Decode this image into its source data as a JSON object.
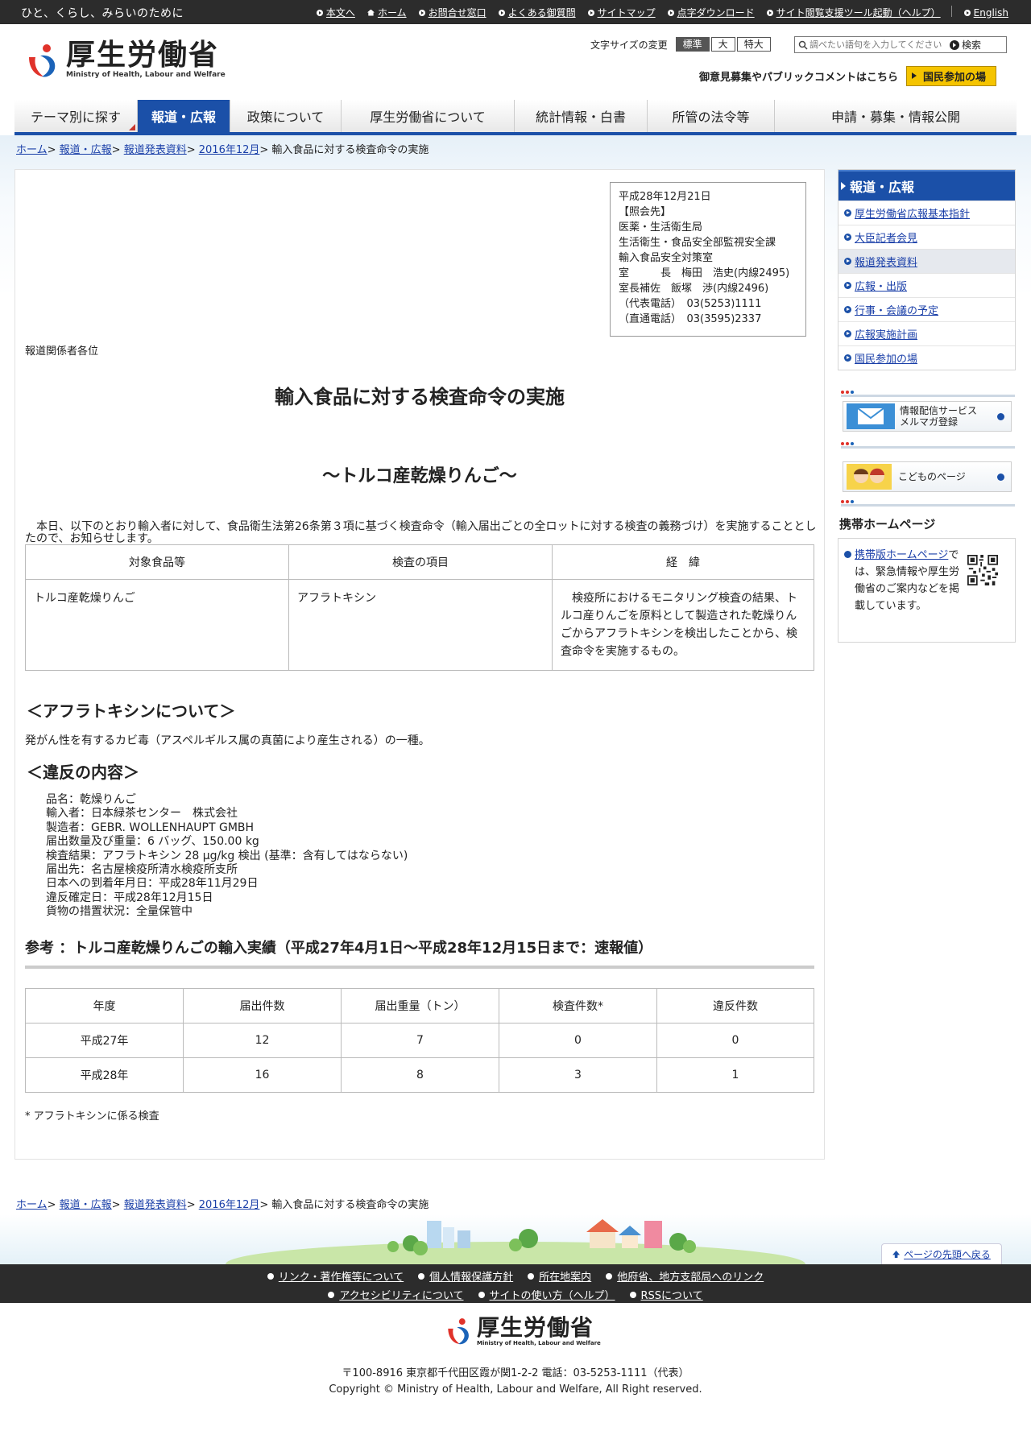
{
  "topbar": {
    "tagline": "ひと、くらし、みらいのために",
    "links": [
      "本文へ",
      "ホーム",
      "お問合せ窓口",
      "よくある御質問",
      "サイトマップ",
      "点字ダウンロード",
      "サイト閲覧支援ツール起動（ヘルプ）"
    ],
    "english": "English"
  },
  "header": {
    "logo_ja": "厚生労働省",
    "logo_en": "Ministry of Health, Labour and Welfare",
    "fontsize_label": "文字サイズの変更",
    "fontsize_options": [
      "標準",
      "大",
      "特大"
    ],
    "search_placeholder": "調べたい語句を入力してください",
    "search_button": "検索",
    "opinion_text": "御意見募集やパブリックコメントはこちら",
    "opinion_button": "国民参加の場"
  },
  "nav": [
    "テーマ別に探す",
    "報道・広報",
    "政策について",
    "厚生労働省について",
    "統計情報・白書",
    "所管の法令等",
    "申請・募集・情報公開"
  ],
  "breadcrumb": {
    "items": [
      "ホーム",
      "報道・広報",
      "報道発表資料",
      "2016年12月"
    ],
    "current": "輸入食品に対する検査命令の実施"
  },
  "contact": "平成28年12月21日\n【照会先】\n医薬・生活衛生局\n生活衛生・食品安全部監視安全課\n輸入食品安全対策室\n室　　　長　梅田　浩史(内線2495)\n室長補佐　飯塚　渉(内線2496)\n（代表電話）　03(5253)1111\n（直通電話）　03(3595)2337",
  "addressee": "報道関係者各位",
  "title": "輸入食品に対する検査命令の実施",
  "subtitle": "～トルコ産乾燥りんご～",
  "intro": "　本日、以下のとおり輸入者に対して、食品衛生法第26条第３項に基づく検査命令（輸入届出ごとの全ロットに対する検査の義務づけ）を実施することとしたので、お知らせします。",
  "table1": {
    "headers": [
      "対象食品等",
      "検査の項目",
      "経　緯"
    ],
    "row": [
      "トルコ産乾燥りんご",
      "アフラトキシン",
      "検疫所におけるモニタリング検査の結果、トルコ産りんごを原料として製造された乾燥りんごからアフラトキシンを検出したことから、検査命令を実施するもの。"
    ]
  },
  "afla_heading": "＜アフラトキシンについて＞",
  "afla_text": "発がん性を有するカビ毒（アスペルギルス属の真菌により産生される）の一種。",
  "violation_heading": "＜違反の内容＞",
  "violation_lines": [
    "品名：乾燥りんご",
    "輸入者：日本緑茶センター　株式会社",
    "製造者：GEBR. WOLLENHAUPT GMBH",
    "届出数量及び重量：6 バッグ、150.00 kg",
    "検査結果：アフラトキシン 28 μg/kg 検出 (基準：含有してはならない)",
    "届出先：名古屋検疫所清水検疫所支所",
    "日本への到着年月日：平成28年11月29日",
    "違反確定日：平成28年12月15日",
    "貨物の措置状況：全量保管中"
  ],
  "reference_title": "参考 ：トルコ産乾燥りんごの輸入実績（平成27年4月1日～平成28年12月15日まで：速報値）",
  "table2": {
    "headers": [
      "年度",
      "届出件数",
      "届出重量（トン）",
      "検査件数*",
      "違反件数"
    ],
    "rows": [
      [
        "平成27年",
        "12",
        "7",
        "0",
        "0"
      ],
      [
        "平成28年",
        "16",
        "8",
        "3",
        "1"
      ]
    ]
  },
  "footnote": "* アフラトキシンに係る検査",
  "sidebar": {
    "heading": "報道・広報",
    "items": [
      "厚生労働省広報基本指針",
      "大臣記者会見",
      "報道発表資料",
      "広報・出版",
      "行事・会議の予定",
      "広報実施計画",
      "国民参加の場"
    ],
    "banner1_line1": "情報配信サービス",
    "banner1_line2": "メルマガ登録",
    "banner2": "こどものページ",
    "mobile_heading": "携帯ホームページ",
    "mobile_link": "携帯版ホームページ",
    "mobile_text": "では、緊急情報や厚生労働省のご案内などを掲載しています。"
  },
  "footer": {
    "pagetop": "ページの先頭へ戻る",
    "links_row1": [
      "リンク・著作権等について",
      "個人情報保護方針",
      "所在地案内",
      "他府省、地方支部局へのリンク"
    ],
    "links_row2": [
      "アクセシビリティについて",
      "サイトの使い方（ヘルプ）",
      "RSSについて"
    ],
    "logo_ja": "厚生労働省",
    "logo_en": "Ministry of Health, Labour and Welfare",
    "address": "〒100-8916 東京都千代田区霞が関1-2-2 電話：03-5253-1111（代表）",
    "copyright": "Copyright © Ministry of Health, Labour and Welfare, All Right reserved."
  },
  "colors": {
    "brand_blue": "#1b50a8",
    "topbar": "#2c2c2c",
    "logo_red": "#e0322a",
    "logo_blue": "#1b63b8",
    "accent_yellow": "#f5c400"
  }
}
